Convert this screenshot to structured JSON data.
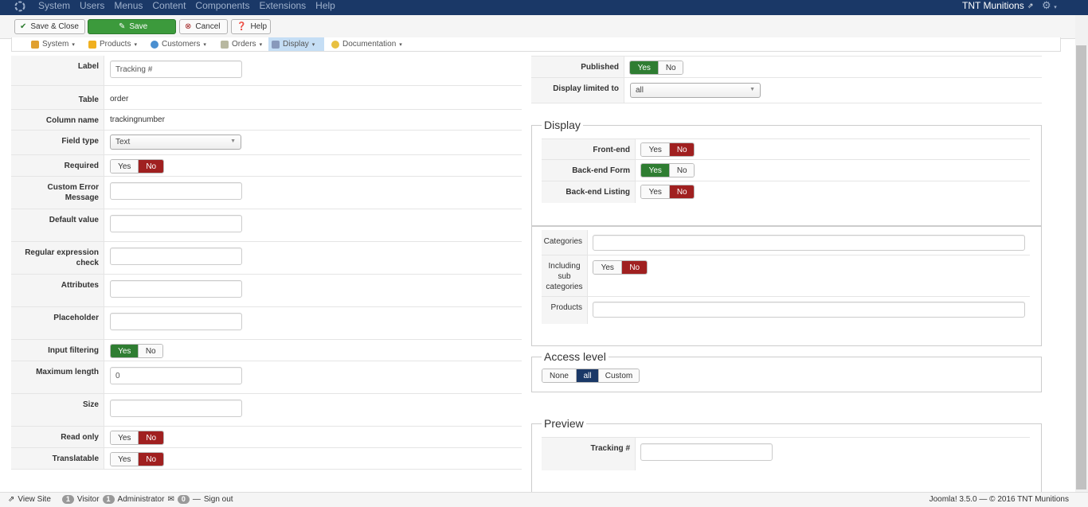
{
  "topbar": {
    "menu": [
      "System",
      "Users",
      "Menus",
      "Content",
      "Components",
      "Extensions",
      "Help"
    ],
    "site_name": "TNT Munitions"
  },
  "toolbar": {
    "save_close": "Save & Close",
    "save": "Save",
    "cancel": "Cancel",
    "help": "Help"
  },
  "submenu": {
    "items": [
      "System",
      "Products",
      "Customers",
      "Orders",
      "Display",
      "Documentation"
    ],
    "active": "Display"
  },
  "form": {
    "label_label": "Label",
    "label_value": "Tracking #",
    "table_label": "Table",
    "table_value": "order",
    "column_label": "Column name",
    "column_value": "trackingnumber",
    "field_type_label": "Field type",
    "field_type_value": "Text",
    "required_label": "Required",
    "custom_error_label": "Custom Error Message",
    "default_value_label": "Default value",
    "regex_label": "Regular expression check",
    "attributes_label": "Attributes",
    "placeholder_label": "Placeholder",
    "input_filtering_label": "Input filtering",
    "max_length_label": "Maximum length",
    "max_length_value": "0",
    "size_label": "Size",
    "read_only_label": "Read only",
    "translatable_label": "Translatable",
    "yes": "Yes",
    "no": "No"
  },
  "right": {
    "published_label": "Published",
    "display_limited_label": "Display limited to",
    "display_limited_value": "all",
    "display_legend": "Display",
    "frontend_label": "Front-end",
    "backend_form_label": "Back-end Form",
    "backend_listing_label": "Back-end Listing",
    "categories_label": "Categories",
    "including_sub_label": "Including sub categories",
    "products_label": "Products",
    "access_legend": "Access level",
    "access_none": "None",
    "access_all": "all",
    "access_custom": "Custom",
    "preview_legend": "Preview",
    "preview_field_label": "Tracking #"
  },
  "footer": {
    "view_site": "View Site",
    "visitor_count": "1",
    "visitor_label": "Visitor",
    "admin_count": "1",
    "admin_label": "Administrator",
    "messages_count": "0",
    "sign_out": "Sign out",
    "version": "Joomla! 3.5.0  —  © 2016 TNT Munitions"
  },
  "colors": {
    "topbar": "#1a3867",
    "green": "#2f7d32",
    "red": "#a02020",
    "blue": "#1a3867"
  }
}
